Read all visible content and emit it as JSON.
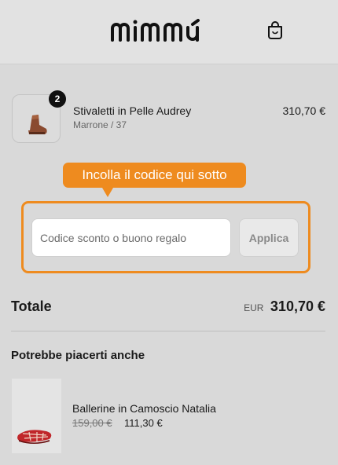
{
  "header": {
    "brand": "mimmú",
    "cart_icon": "shopping-bag-icon"
  },
  "cart_item": {
    "name": "Stivaletti in Pelle Audrey",
    "variant": "Marrone / 37",
    "price": "310,70 €",
    "quantity": "2"
  },
  "tooltip": {
    "text": "Incolla il codice qui sotto",
    "color": "#ee8b1f"
  },
  "discount": {
    "placeholder": "Codice sconto o buono regalo",
    "apply_label": "Applica"
  },
  "summary": {
    "total_label": "Totale",
    "currency": "EUR",
    "total_amount": "310,70 €"
  },
  "recommendations": {
    "title": "Potrebbe piacerti anche",
    "items": [
      {
        "name": "Ballerine in Camoscio Natalia",
        "old_price": "159,00 €",
        "price": "111,30 €"
      }
    ]
  }
}
